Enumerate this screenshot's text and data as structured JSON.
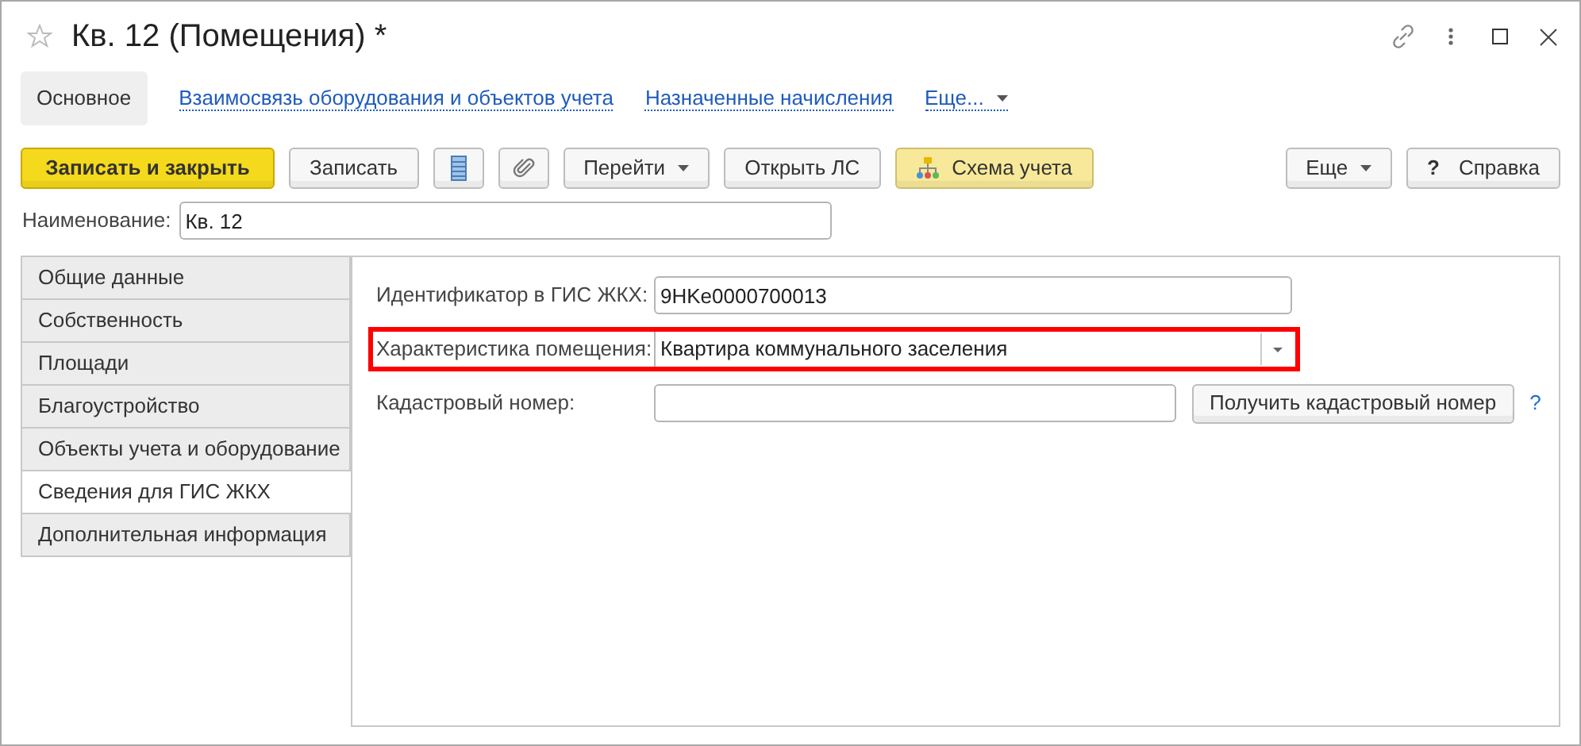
{
  "window": {
    "title": "Кв. 12 (Помещения) *"
  },
  "nav": [
    {
      "label": "Основное",
      "selected": true,
      "kind": "link"
    },
    {
      "label": "Взаимосвязь оборудования и объектов учета",
      "selected": false,
      "kind": "link"
    },
    {
      "label": "Назначенные начисления",
      "selected": false,
      "kind": "link"
    },
    {
      "label": "Еще...",
      "selected": false,
      "kind": "menu"
    }
  ],
  "toolbar": [
    {
      "kind": "primary",
      "label": "Записать и закрыть"
    },
    {
      "kind": "plain",
      "label": "Записать"
    },
    {
      "kind": "list-icon"
    },
    {
      "kind": "clip-icon"
    },
    {
      "kind": "dropdown",
      "label": "Перейти"
    },
    {
      "kind": "plain",
      "label": "Открыть ЛС"
    },
    {
      "kind": "scheme",
      "label": "Схема учета"
    }
  ],
  "toolbar_right": [
    {
      "kind": "dropdown",
      "label": "Еще"
    },
    {
      "kind": "help",
      "label": "Справка",
      "mark": "?"
    }
  ],
  "name_field": {
    "label": "Наименование:",
    "value": "Кв. 12"
  },
  "side_tabs": [
    {
      "label": "Общие данные",
      "selected": false
    },
    {
      "label": "Собственность",
      "selected": false
    },
    {
      "label": "Площади",
      "selected": false
    },
    {
      "label": "Благоустройство",
      "selected": false
    },
    {
      "label": "Объекты учета и оборудование",
      "selected": false
    },
    {
      "label": "Сведения для ГИС ЖКХ",
      "selected": true
    },
    {
      "label": "Дополнительная информация",
      "selected": false
    }
  ],
  "fields": [
    {
      "kind": "text",
      "label": "Идентификатор в ГИС ЖКХ:",
      "value": "9HKe0000700013",
      "highlighted": false
    },
    {
      "kind": "select",
      "label": "Характеристика помещения:",
      "value": "Квартира коммунального заселения",
      "highlighted": true
    },
    {
      "kind": "text-button",
      "label": "Кадастровый номер:",
      "button": "Получить кадастровый номер",
      "help": "?",
      "highlighted": false
    }
  ]
}
